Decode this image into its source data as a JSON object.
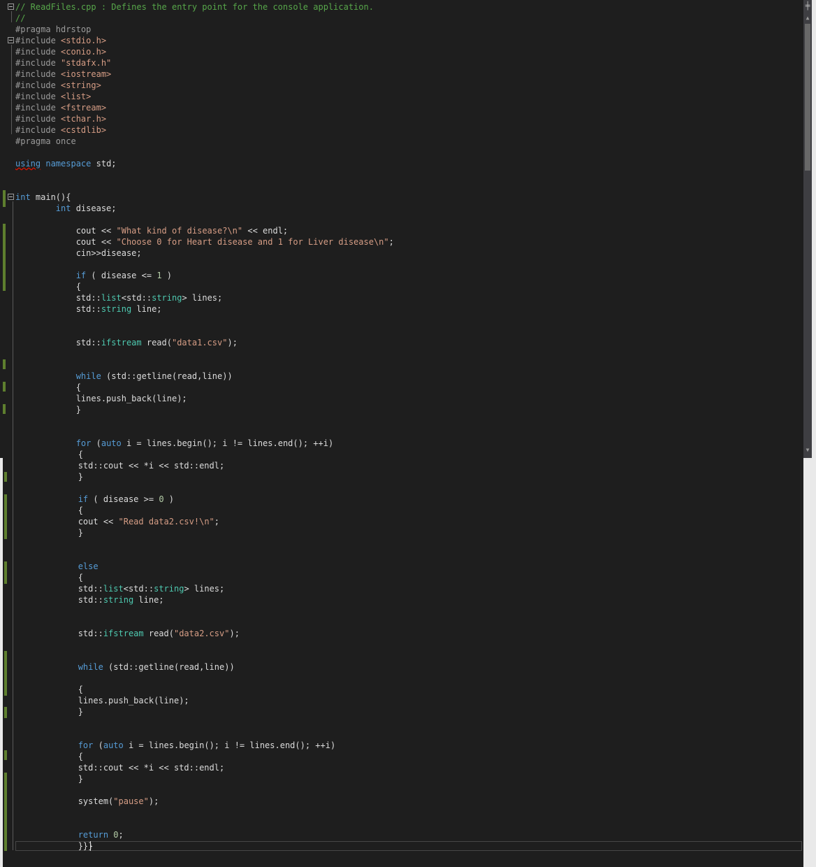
{
  "editor": {
    "lines": [
      {
        "html": "<span class=\"cm\">// ReadFiles.cpp : Defines the entry point for the console application.</span>"
      },
      {
        "html": "<span class=\"cm\">//</span>"
      },
      {
        "html": "<span class=\"pp\">#pragma hdrstop</span>"
      },
      {
        "html": "<span class=\"pp\">#include </span><span class=\"str\">&lt;stdio.h&gt;</span>"
      },
      {
        "html": "<span class=\"pp\">#include </span><span class=\"str\">&lt;conio.h&gt;</span>"
      },
      {
        "html": "<span class=\"pp\">#include </span><span class=\"str\">\"stdafx.h\"</span>"
      },
      {
        "html": "<span class=\"pp\">#include </span><span class=\"str\">&lt;iostream&gt;</span>"
      },
      {
        "html": "<span class=\"pp\">#include </span><span class=\"str\">&lt;string&gt;</span>"
      },
      {
        "html": "<span class=\"pp\">#include </span><span class=\"str\">&lt;list&gt;</span>"
      },
      {
        "html": "<span class=\"pp\">#include </span><span class=\"str\">&lt;fstream&gt;</span>"
      },
      {
        "html": "<span class=\"pp\">#include </span><span class=\"str\">&lt;tchar.h&gt;</span>"
      },
      {
        "html": "<span class=\"pp\">#include </span><span class=\"str\">&lt;cstdlib&gt;</span>"
      },
      {
        "html": "<span class=\"pp\">#pragma once</span>"
      },
      {
        "html": ""
      },
      {
        "html": "<span class=\"kw squig\">using</span> <span class=\"kw\">namespace</span> std;"
      },
      {
        "html": ""
      },
      {
        "html": ""
      },
      {
        "html": "<span class=\"kw\">int</span> main(){"
      },
      {
        "html": "        <span class=\"kw\">int</span> disease;"
      },
      {
        "html": ""
      },
      {
        "html": "            cout &lt;&lt; <span class=\"str\">\"What kind of disease?\\n\"</span> &lt;&lt; endl;"
      },
      {
        "html": "            cout &lt;&lt; <span class=\"str\">\"Choose 0 for Heart disease and 1 for Liver disease\\n\"</span>;"
      },
      {
        "html": "            cin&gt;&gt;disease;"
      },
      {
        "html": ""
      },
      {
        "html": "            <span class=\"kw\">if</span> ( disease &lt;= <span class=\"num\">1</span> )"
      },
      {
        "html": "            {"
      },
      {
        "html": "            std::<span class=\"ty\">list</span>&lt;std::<span class=\"ty\">string</span>&gt; lines;"
      },
      {
        "html": "            std::<span class=\"ty\">string</span> line;"
      },
      {
        "html": ""
      },
      {
        "html": ""
      },
      {
        "html": "            std::<span class=\"ty\">ifstream</span> read(<span class=\"str\">\"data1.csv\"</span>);"
      },
      {
        "html": ""
      },
      {
        "html": ""
      },
      {
        "html": "            <span class=\"kw\">while</span> (std::getline(read,line))"
      },
      {
        "html": "            {"
      },
      {
        "html": "            lines.push_back(line);"
      },
      {
        "html": "            }"
      },
      {
        "html": ""
      },
      {
        "html": ""
      },
      {
        "html": "            <span class=\"kw\">for</span> (<span class=\"kw\">auto</span> i = lines.begin(); i != lines.end(); ++i)"
      }
    ],
    "lines2": [
      {
        "html": "            {"
      },
      {
        "html": "            std::cout &lt;&lt; *i &lt;&lt; std::endl;"
      },
      {
        "html": "            }"
      },
      {
        "html": ""
      },
      {
        "html": "            <span class=\"kw\">if</span> ( disease &gt;= <span class=\"num\">0</span> )"
      },
      {
        "html": "            {"
      },
      {
        "html": "            cout &lt;&lt; <span class=\"str\">\"Read data2.csv!\\n\"</span>;"
      },
      {
        "html": "            }"
      },
      {
        "html": ""
      },
      {
        "html": ""
      },
      {
        "html": "            <span class=\"kw\">else</span>"
      },
      {
        "html": "            {"
      },
      {
        "html": "            std::<span class=\"ty\">list</span>&lt;std::<span class=\"ty\">string</span>&gt; lines;"
      },
      {
        "html": "            std::<span class=\"ty\">string</span> line;"
      },
      {
        "html": ""
      },
      {
        "html": ""
      },
      {
        "html": "            std::<span class=\"ty\">ifstream</span> read(<span class=\"str\">\"data2.csv\"</span>);"
      },
      {
        "html": ""
      },
      {
        "html": ""
      },
      {
        "html": "            <span class=\"kw\">while</span> (std::getline(read,line))"
      },
      {
        "html": ""
      },
      {
        "html": "            {"
      },
      {
        "html": "            lines.push_back(line);"
      },
      {
        "html": "            }"
      },
      {
        "html": ""
      },
      {
        "html": ""
      },
      {
        "html": "            <span class=\"kw\">for</span> (<span class=\"kw\">auto</span> i = lines.begin(); i != lines.end(); ++i)"
      },
      {
        "html": "            {"
      },
      {
        "html": "            std::cout &lt;&lt; *i &lt;&lt; std::endl;"
      },
      {
        "html": "            }"
      },
      {
        "html": ""
      },
      {
        "html": "            system(<span class=\"str\">\"pause\"</span>);"
      },
      {
        "html": ""
      },
      {
        "html": ""
      },
      {
        "html": "            <span class=\"kw\">return</span> <span class=\"num\">0</span>;"
      },
      {
        "html": "            }}}"
      }
    ]
  },
  "icons": {
    "fold": "fold-toggle-icon",
    "split": "split-window-icon",
    "scroll_up": "scroll-up-arrow-icon",
    "scroll_down": "scroll-down-arrow-icon"
  },
  "colors": {
    "background": "#1e1e1e",
    "keyword": "#569cd6",
    "type": "#4ec9b0",
    "string": "#d69d85",
    "comment": "#57a64a",
    "change_bar": "#5e7f2e"
  }
}
